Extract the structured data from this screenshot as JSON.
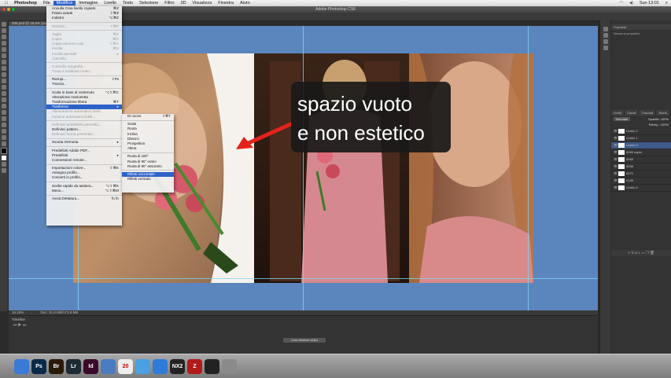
{
  "menubar": {
    "app": "Photoshop",
    "items": [
      "File",
      "Modifica",
      "Immagine",
      "Livello",
      "Testo",
      "Selezione",
      "Filtro",
      "3D",
      "Visualizza",
      "Finestra",
      "Aiuto"
    ],
    "clock": "Sun 13:01"
  },
  "window": {
    "title": "Adobe Photoshop CS6",
    "doc_tab": "008.psd @ 16,6% (Livello 0, RGB/8)",
    "status_zoom": "16,18%",
    "status_doc": "Doc: 31,8 MB/173,8 MB",
    "timeline_title": "Timeline",
    "timeline_button": "Crea timeline video"
  },
  "edit_menu": {
    "items": [
      {
        "label": "Annulla Crea livello copiato",
        "shortcut": "⌘Z",
        "disabled": false
      },
      {
        "label": "Passo avanti",
        "shortcut": "⇧⌘Z",
        "disabled": false
      },
      {
        "label": "Indietro",
        "shortcut": "⌥⌘Z",
        "disabled": false
      },
      {
        "sep": true
      },
      {
        "label": "Dissolvi...",
        "shortcut": "⇧⌘F",
        "disabled": true
      },
      {
        "sep": true
      },
      {
        "label": "Taglia",
        "shortcut": "⌘X",
        "disabled": true
      },
      {
        "label": "Copia",
        "shortcut": "⌘C",
        "disabled": true
      },
      {
        "label": "Copia elementi uniti",
        "shortcut": "⇧⌘C",
        "disabled": true
      },
      {
        "label": "Incolla",
        "shortcut": "⌘V",
        "disabled": true
      },
      {
        "label": "Incolla speciale",
        "shortcut": "▸",
        "disabled": true
      },
      {
        "label": "Cancella",
        "shortcut": "",
        "disabled": true
      },
      {
        "sep": true
      },
      {
        "label": "Controllo ortografia...",
        "shortcut": "",
        "disabled": true
      },
      {
        "label": "Trova e sostituisci testo...",
        "shortcut": "",
        "disabled": true
      },
      {
        "sep": true
      },
      {
        "label": "Riempi...",
        "shortcut": "⇧F5",
        "disabled": false
      },
      {
        "label": "Traccia...",
        "shortcut": "",
        "disabled": false
      },
      {
        "sep": true
      },
      {
        "label": "Scala in base al contenuto",
        "shortcut": "⌥⇧⌘C",
        "disabled": false
      },
      {
        "label": "Alterazione marionetta",
        "shortcut": "",
        "disabled": false
      },
      {
        "label": "Trasformazione libera",
        "shortcut": "⌘T",
        "disabled": false
      },
      {
        "label": "Trasforma",
        "shortcut": "▸",
        "disabled": false,
        "highlighted": true
      },
      {
        "label": "Allineamento automatico livelli...",
        "shortcut": "",
        "disabled": true
      },
      {
        "label": "Fusione automatica livelli...",
        "shortcut": "",
        "disabled": true
      },
      {
        "sep": true
      },
      {
        "label": "Definisci predefinito pennello...",
        "shortcut": "",
        "disabled": true
      },
      {
        "label": "Definisci pattern...",
        "shortcut": "",
        "disabled": false
      },
      {
        "label": "Definisci forma personale...",
        "shortcut": "",
        "disabled": true
      },
      {
        "sep": true
      },
      {
        "label": "Svuota memoria",
        "shortcut": "▸",
        "disabled": false
      },
      {
        "sep": true
      },
      {
        "label": "Predefiniti Adobe PDF...",
        "shortcut": "",
        "disabled": false
      },
      {
        "label": "Predefiniti",
        "shortcut": "▸",
        "disabled": false
      },
      {
        "label": "Connessioni remote...",
        "shortcut": "",
        "disabled": false
      },
      {
        "sep": true
      },
      {
        "label": "Impostazioni colore...",
        "shortcut": "⇧⌘K",
        "disabled": false
      },
      {
        "label": "Assegna profilo...",
        "shortcut": "",
        "disabled": false
      },
      {
        "label": "Converti in profilo...",
        "shortcut": "",
        "disabled": false
      },
      {
        "sep": true
      },
      {
        "label": "Scelte rapide da tastiera...",
        "shortcut": "⌥⇧⌘K",
        "disabled": false
      },
      {
        "label": "Menu...",
        "shortcut": "⌥⇧⌘M",
        "disabled": false
      },
      {
        "sep": true
      },
      {
        "label": "Avvia Dettatura...",
        "shortcut": "fn fn",
        "disabled": false
      }
    ]
  },
  "transform_submenu": {
    "items": [
      {
        "label": "Di nuovo",
        "shortcut": "⇧⌘T",
        "highlighted": false
      },
      {
        "sep": true
      },
      {
        "label": "Scala",
        "shortcut": "",
        "highlighted": false
      },
      {
        "label": "Ruota",
        "shortcut": "",
        "highlighted": false
      },
      {
        "label": "Inclina",
        "shortcut": "",
        "highlighted": false
      },
      {
        "label": "Distorci",
        "shortcut": "",
        "highlighted": false
      },
      {
        "label": "Prospettiva",
        "shortcut": "",
        "highlighted": false
      },
      {
        "label": "Altera",
        "shortcut": "",
        "highlighted": false
      },
      {
        "sep": true
      },
      {
        "label": "Ruota di 180°",
        "shortcut": "",
        "highlighted": false
      },
      {
        "label": "Ruota di 90° orario",
        "shortcut": "",
        "highlighted": false
      },
      {
        "label": "Ruota di 90° antiorario",
        "shortcut": "",
        "highlighted": false
      },
      {
        "sep": true
      },
      {
        "label": "Rifletti orizzontale",
        "shortcut": "",
        "highlighted": true
      },
      {
        "label": "Rifletti verticale",
        "shortcut": "",
        "highlighted": false
      }
    ]
  },
  "annotation": {
    "line1": "spazio vuoto",
    "line2": "e non estetico",
    "arrow_color": "#e3231b"
  },
  "panels": {
    "properties_title": "Proprietà",
    "properties_empty": "Nessuna proprietà",
    "tabs": [
      "Livelli",
      "Canali",
      "Tracciati",
      "Storia"
    ],
    "blend_mode": "Normale",
    "opacity_label": "Opacità:",
    "opacity_value": "100%",
    "fill_label": "Riemp.:",
    "fill_value": "100%",
    "layers": [
      {
        "name": "Livello 2",
        "active": false
      },
      {
        "name": "Livello 1",
        "active": false
      },
      {
        "name": "Livello 0",
        "active": true
      },
      {
        "name": "0065 copia",
        "active": false
      },
      {
        "name": "0065",
        "active": false
      },
      {
        "name": "0058",
        "active": false
      },
      {
        "name": "0072",
        "active": false
      },
      {
        "name": "0155",
        "active": false
      },
      {
        "name": "Livello 0",
        "active": false
      }
    ]
  },
  "dock": {
    "apps": [
      {
        "icon": "finder-icon",
        "text": "",
        "color": "#3a7bd5"
      },
      {
        "icon": "photoshop-icon",
        "text": "Ps",
        "color": "#0a2a4a"
      },
      {
        "icon": "bridge-icon",
        "text": "Br",
        "color": "#2a1a08"
      },
      {
        "icon": "lightroom-icon",
        "text": "Lr",
        "color": "#1d2a33"
      },
      {
        "icon": "indesign-icon",
        "text": "Id",
        "color": "#3a0a2a"
      },
      {
        "icon": "mail-icon",
        "text": "",
        "color": "#4a7cc0"
      },
      {
        "icon": "calendar-icon",
        "text": "20",
        "color": "#eeeeee"
      },
      {
        "icon": "itunes-icon",
        "text": "",
        "color": "#4aa0e0"
      },
      {
        "icon": "appstore-icon",
        "text": "",
        "color": "#2f7bd8"
      },
      {
        "icon": "nx2-icon",
        "text": "NX2",
        "color": "#222222"
      },
      {
        "icon": "filezilla-icon",
        "text": "Z",
        "color": "#b31b1b"
      },
      {
        "icon": "terminal-icon",
        "text": "",
        "color": "#222222"
      },
      {
        "icon": "trash-icon",
        "text": "",
        "color": "#8a8a8a"
      }
    ]
  }
}
